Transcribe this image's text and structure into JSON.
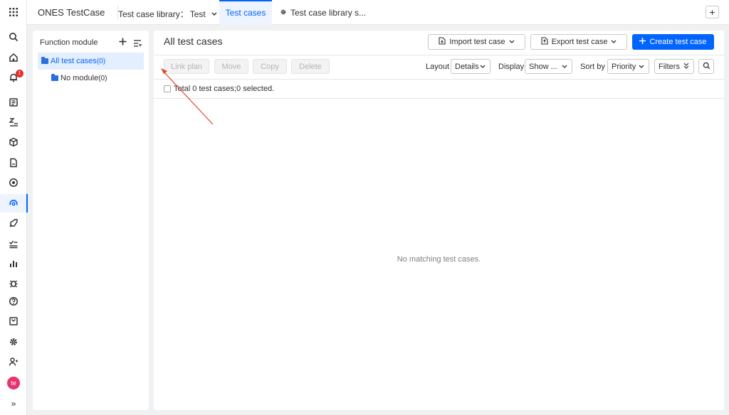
{
  "rail": {
    "icons": [
      "apps-grid-icon",
      "search-icon",
      "home-icon",
      "bell-icon",
      "wiki-icon",
      "sort-icon",
      "cube-icon",
      "document-icon",
      "target-icon",
      "testcase-icon",
      "rocket-icon",
      "checklist-icon",
      "analytics-icon",
      "bug-icon",
      "help-icon",
      "inbox-icon",
      "gear-icon",
      "add-user-icon"
    ],
    "notification_count": "1",
    "avatar_initials": "te",
    "expand_label": "»"
  },
  "header": {
    "app_title": "ONES TestCase",
    "library_label": "Test case library：",
    "library_value": "Test",
    "tab_test_cases": "Test cases",
    "tab_library_settings": "Test case library s...",
    "add_label": "+"
  },
  "function_module": {
    "title": "Function module",
    "items": [
      {
        "label": "All test cases",
        "count": "(0)"
      },
      {
        "label": "No module",
        "count": "(0)"
      }
    ]
  },
  "main": {
    "title": "All test cases",
    "import_label": "Import test case",
    "export_label": "Export test case",
    "create_label": "Create test case",
    "actions": [
      "Link plan",
      "Move",
      "Copy",
      "Delete"
    ],
    "layout_label": "Layout",
    "layout_value": "Details",
    "display_label": "Display",
    "display_value": "Show ...",
    "sort_label": "Sort by",
    "sort_value": "Priority",
    "filters_label": "Filters",
    "total_text": "Total 0 test cases;0 selected.",
    "empty_text": "No matching test cases."
  },
  "colors": {
    "accent": "#0064ff",
    "annotation_arrow": "#e8432e",
    "badge": "#e52f2f",
    "avatar": "#e8336b"
  }
}
